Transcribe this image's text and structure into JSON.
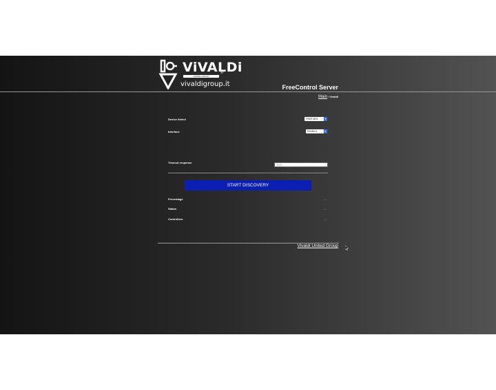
{
  "header": {
    "logo_name": "ViVALDi",
    "logo_tagline": "UNITED GROUP",
    "logo_registered": "®",
    "logo_url": "vivaldigroup.it",
    "app_title": "FreeControl Server"
  },
  "breadcrumb": {
    "main": "Main",
    "separator": "/",
    "current": "Vivaldi"
  },
  "form": {
    "device_select_label": "Device Select",
    "device_select_value": "FREE MK3",
    "interface_label": "Interface",
    "interface_value": "RS485-A",
    "timeout_label": "Timeout response",
    "timeout_value": "1500",
    "start_button": "START DISCOVERY"
  },
  "status": {
    "percentage_label": "Precentage",
    "percentage_value": "...",
    "status_label": "Status",
    "status_value": "...",
    "controllers_label": "Controllers",
    "controllers_value": "..."
  },
  "footer": {
    "link": "Vivaldi United Group"
  },
  "colors": {
    "button": "#0b1fb4",
    "select_arrow": "#2d6fe0"
  }
}
